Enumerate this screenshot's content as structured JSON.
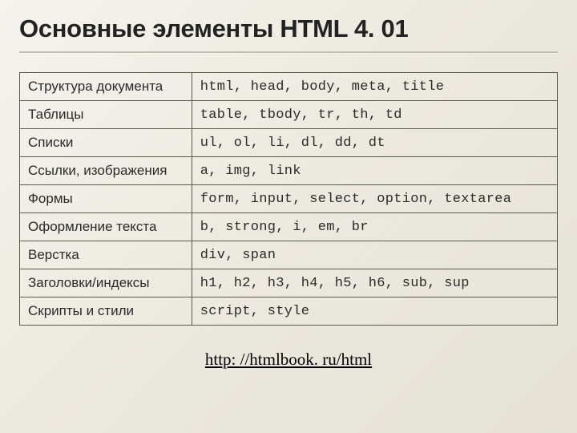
{
  "title": "Основные элементы HTML 4. 01",
  "rows": [
    {
      "label": "Структура документа",
      "items": "html, head, body, meta, title"
    },
    {
      "label": "Таблицы",
      "items": "table, tbody, tr, th, td"
    },
    {
      "label": "Списки",
      "items": "ul, ol, li, dl, dd, dt"
    },
    {
      "label": "Ссылки, изображения",
      "items": "a, img, link"
    },
    {
      "label": "Формы",
      "items": "form, input, select, option, textarea"
    },
    {
      "label": "Оформление текста",
      "items": "b, strong, i, em, br"
    },
    {
      "label": "Верстка",
      "items": "div, span"
    },
    {
      "label": "Заголовки/индексы",
      "items": "h1, h2, h3, h4, h5, h6, sub, sup"
    },
    {
      "label": "Скрипты и стили",
      "items": "script, style"
    }
  ],
  "link": "http: //htmlbook. ru/html"
}
